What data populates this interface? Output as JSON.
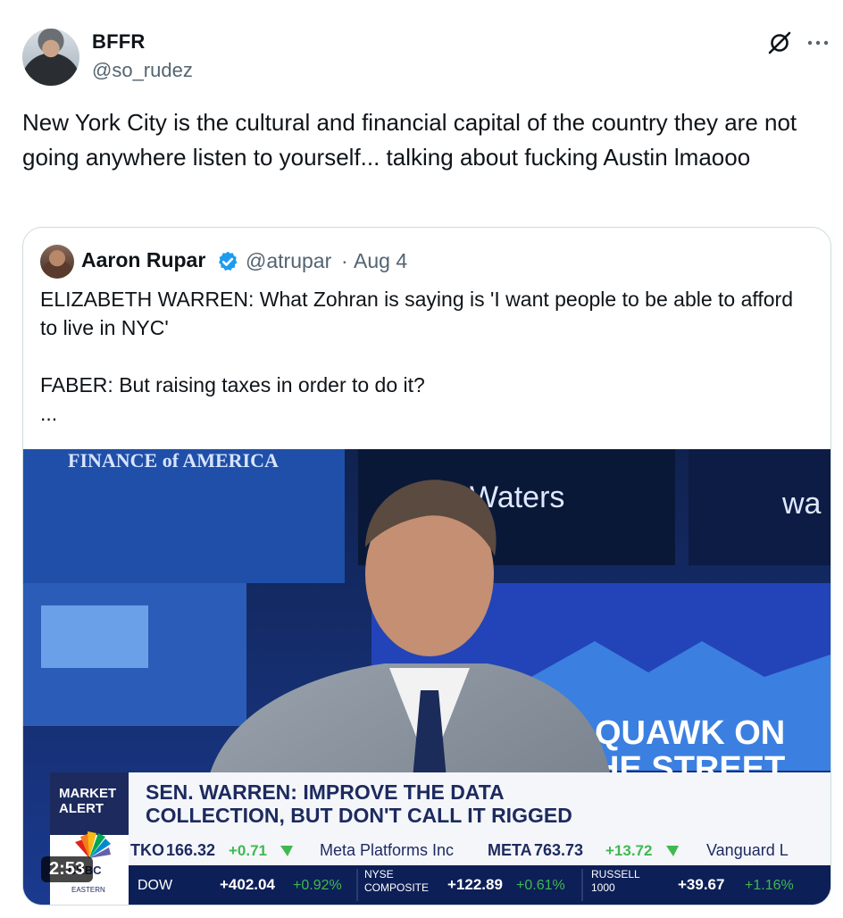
{
  "author": {
    "display_name": "BFFR",
    "handle": "@so_rudez",
    "avatar_icon": "user-avatar"
  },
  "post": {
    "text": "New York City is the cultural and financial capital of the country they are not going anywhere listen to yourself... talking about fucking Austin lmaooo"
  },
  "quoted": {
    "display_name": "Aaron Rupar",
    "handle": "@atrupar",
    "separator": "·",
    "date": "Aug 4",
    "text": "ELIZABETH WARREN: What Zohran is saying is 'I want people to be able to afford to live in NYC'\n\nFABER: But raising taxes in order to do it?\n...",
    "verified_color": "#1d9bf0"
  },
  "video": {
    "duration": "2:53",
    "wall_sign": "FINANCE of AMERICA",
    "wall_brand_1": "Waters",
    "wall_brand_2": "wa",
    "show_title_1": "QUAWK ON",
    "show_title_2": "HE STREET",
    "alert_label_1": "MARKET",
    "alert_label_2": "ALERT",
    "headline_1": "SEN. WARREN: IMPROVE THE DATA",
    "headline_2": "COLLECTION, BUT DON'T CALL IT RIGGED",
    "ticker_top": {
      "item1_name": "TKO",
      "item1_price": "166.32",
      "item1_change": "+0.71",
      "item2_name": "Meta Platforms Inc",
      "item2_symbol": "META",
      "item2_price": "763.73",
      "item2_change": "+13.72",
      "item3_name": "Vanguard L"
    },
    "ticker_bottom": {
      "dow_label": "DOW",
      "dow_value": "+402.04",
      "dow_pct": "+0.92%",
      "nyse_label_1": "NYSE",
      "nyse_label_2": "COMPOSITE",
      "nyse_value": "+122.89",
      "nyse_pct": "+0.61%",
      "russell_label_1": "RUSSELL",
      "russell_label_2": "1000",
      "russell_value": "+39.67",
      "russell_pct": "+1.16%"
    },
    "network_logo": "CNBC",
    "network_sub": "EASTERN"
  },
  "colors": {
    "text_primary": "#0f1419",
    "text_secondary": "#536471",
    "border": "#cfd9de",
    "ticker_green": "#3fb950",
    "headline_navy": "#1c2a5e"
  }
}
